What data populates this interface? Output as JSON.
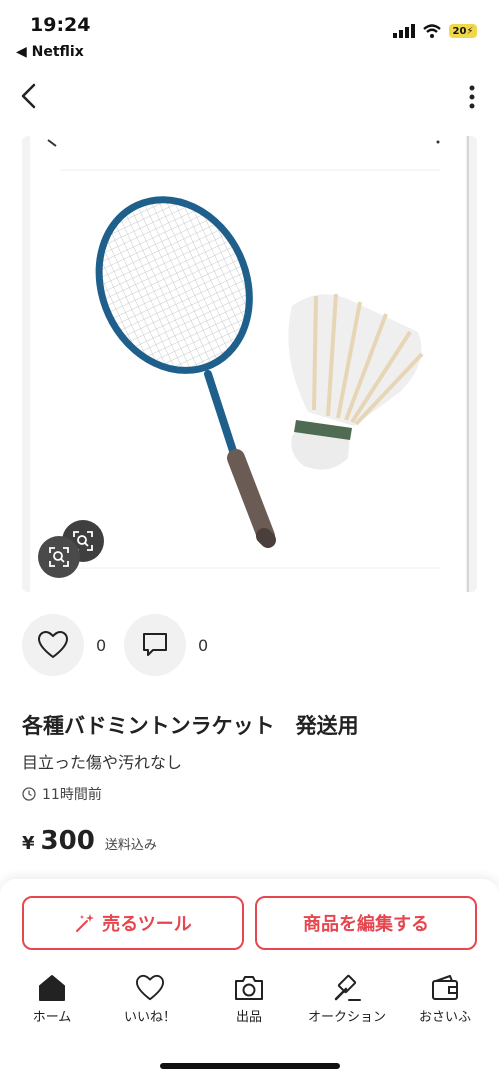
{
  "status_bar": {
    "time": "19:24",
    "back_app": "◀ Netflix",
    "battery": "20"
  },
  "item": {
    "likes_count": "0",
    "comments_count": "0",
    "title": "各種バドミントンラケット　発送用",
    "description": "目立った傷や汚れなし",
    "posted": "11時間前",
    "price_symbol": "¥",
    "price": "300",
    "shipping_note": "送料込み"
  },
  "actions": {
    "sell_tools": "売るツール",
    "edit_item": "商品を編集する"
  },
  "tabbar": [
    {
      "label": "ホーム",
      "icon": "home-icon"
    },
    {
      "label": "いいね！",
      "icon": "heart-icon"
    },
    {
      "label": "出品",
      "icon": "camera-icon"
    },
    {
      "label": "オークション",
      "icon": "gavel-icon"
    },
    {
      "label": "おさいふ",
      "icon": "wallet-icon"
    }
  ],
  "colors": {
    "accent": "#e6474f",
    "racket_frame": "#1f5f8b",
    "grip": "#6b5b55"
  }
}
